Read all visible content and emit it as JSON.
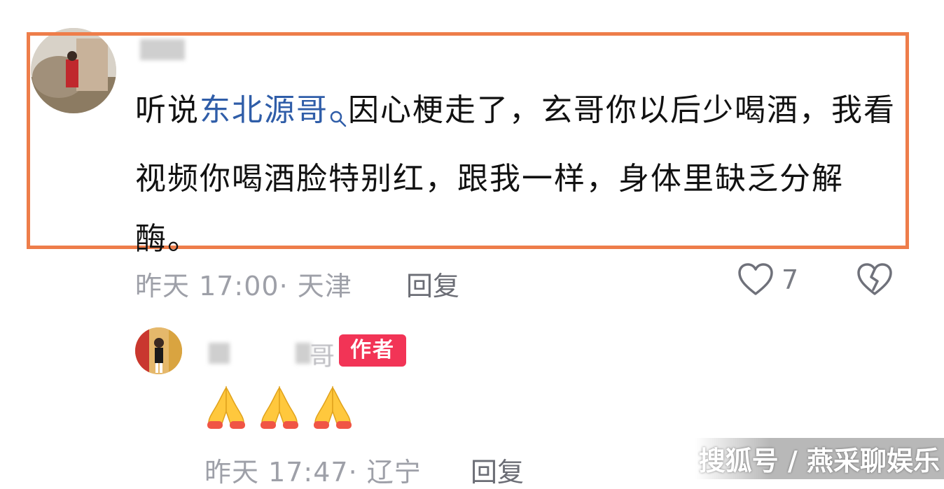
{
  "comment": {
    "text_prefix": "听说",
    "mention": "东北源哥",
    "text_suffix": "因心梗走了，玄哥你以后少喝酒，我看视频你喝酒脸特别红，跟我一样，身体里缺乏分解酶。",
    "meta": "昨天 17:00· 天津",
    "reply_label": "回复",
    "like_count": "7"
  },
  "reply": {
    "author_tag": "作者",
    "name_visible_char": "哥",
    "meta": "昨天 17:47· 辽宁",
    "reply_label": "回复"
  },
  "watermark": "搜狐号 / 燕采聊娱乐",
  "colors": {
    "highlight_border": "#ee7d4a",
    "mention_link": "#2f5da8",
    "author_tag_bg": "#f23456",
    "meta_text": "#9ea0a8"
  },
  "icons": [
    "search-icon",
    "heart-outline-icon",
    "broken-heart-icon",
    "folded-hands-emoji"
  ]
}
